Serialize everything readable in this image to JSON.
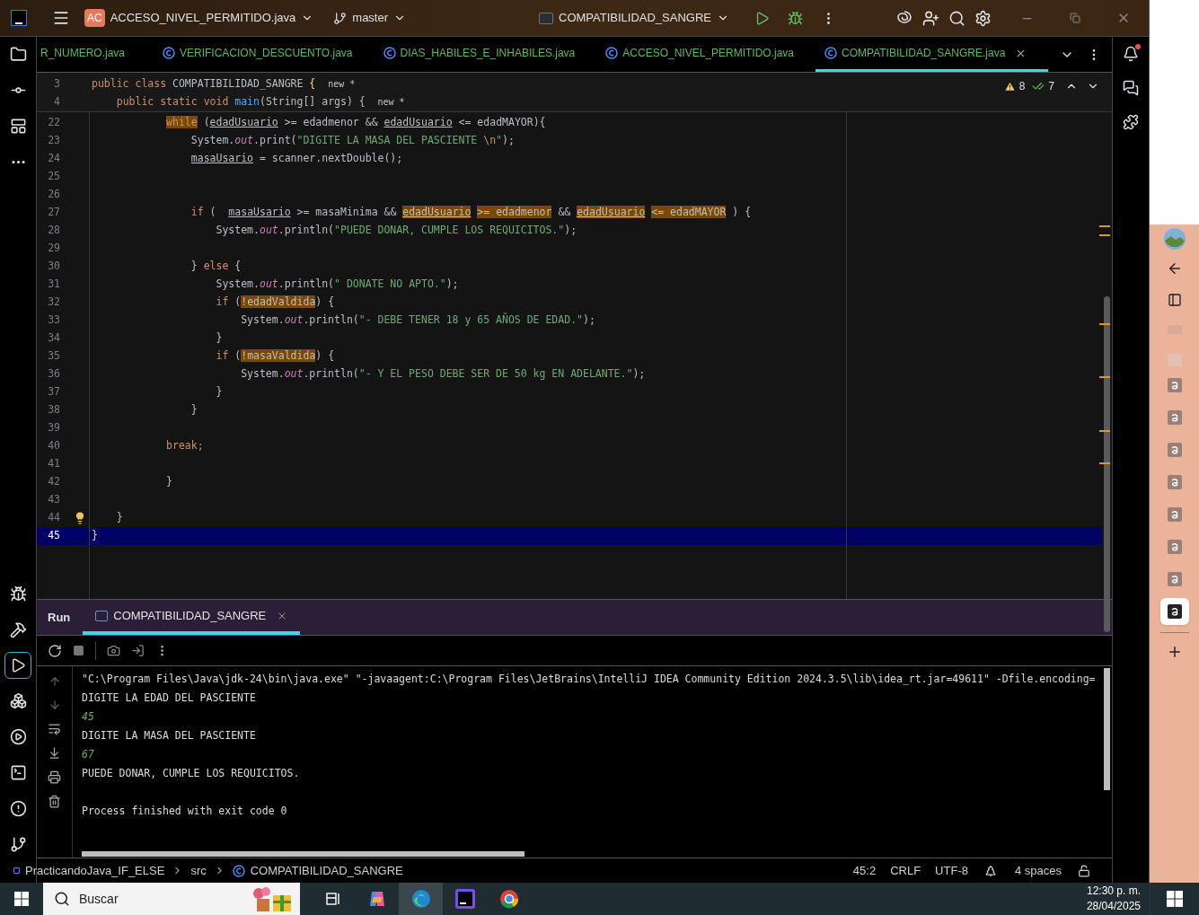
{
  "title_bar": {
    "project_badge": "AC",
    "project": "ACCESO_NIVEL_PERMITIDO.java",
    "branch": "master",
    "run_config": "COMPATIBILIDAD_SANGRE"
  },
  "tabs": [
    {
      "label": "R_NUMERO.java",
      "selected": false,
      "icon": false
    },
    {
      "label": "VERIFICACION_DESCUENTO.java",
      "selected": false,
      "icon": true
    },
    {
      "label": "DIAS_HABILES_E_INHABILES.java",
      "selected": false,
      "icon": true
    },
    {
      "label": "ACCESO_NIVEL_PERMITIDO.java",
      "selected": false,
      "icon": true
    },
    {
      "label": "COMPATIBILIDAD_SANGRE.java",
      "selected": true,
      "icon": true
    }
  ],
  "inspections": {
    "warnings": "8",
    "weak_warnings": "7"
  },
  "sticky_lines": [
    {
      "number": "3",
      "tokens": [
        {
          "kind": "kw",
          "text": "public class "
        },
        {
          "kind": "plain",
          "text": "COMPATIBILIDAD_SANGRE "
        },
        {
          "kind": "brace",
          "text": "{"
        },
        {
          "kind": "hint",
          "text": "  new *"
        }
      ]
    },
    {
      "number": "4",
      "tokens": [
        {
          "kind": "kw",
          "text": "    public static void "
        },
        {
          "kind": "fn",
          "text": "main"
        },
        {
          "kind": "plain",
          "text": "(String[] args) {"
        },
        {
          "kind": "hint",
          "text": "  new *"
        }
      ]
    }
  ],
  "code_lines": [
    {
      "number": "22",
      "current": false,
      "tokens": [
        {
          "kind": "hlkw",
          "text": "            while"
        },
        {
          "kind": "plain",
          "text": " ("
        },
        {
          "kind": "var",
          "text": "edadUsuario"
        },
        {
          "kind": "plain",
          "text": " >= edadmenor && "
        },
        {
          "kind": "var",
          "text": "edadUsuario"
        },
        {
          "kind": "plain",
          "text": " <= edadMAYOR){"
        }
      ]
    },
    {
      "number": "23",
      "current": false,
      "tokens": [
        {
          "kind": "plain",
          "text": "                System."
        },
        {
          "kind": "field",
          "text": "out"
        },
        {
          "kind": "plain",
          "text": ".print("
        },
        {
          "kind": "str",
          "text": "\"DIGITE LA MASA DEL PASCIENTE "
        },
        {
          "kind": "kw",
          "text": "\\n"
        },
        {
          "kind": "str",
          "text": "\""
        },
        {
          "kind": "plain",
          "text": ");"
        }
      ]
    },
    {
      "number": "24",
      "current": false,
      "tokens": [
        {
          "kind": "var",
          "text": "                masaUsario"
        },
        {
          "kind": "plain",
          "text": " = scanner.nextDouble();"
        }
      ]
    },
    {
      "number": "25",
      "current": false
    },
    {
      "number": "26",
      "current": false
    },
    {
      "number": "27",
      "current": false,
      "tokens": [
        {
          "kind": "kw",
          "text": "                if"
        },
        {
          "kind": "plain",
          "text": " (  "
        },
        {
          "kind": "var",
          "text": "masaUsario"
        },
        {
          "kind": "plain",
          "text": " >= masaMinima && "
        },
        {
          "kind": "hlvar",
          "text": "edadUsuario"
        },
        {
          "kind": "hl",
          "text": " >= edadmenor"
        },
        {
          "kind": "plain",
          "text": " && "
        },
        {
          "kind": "hlvar",
          "text": "edadUsuario"
        },
        {
          "kind": "hl",
          "text": " <= edadMAYOR"
        },
        {
          "kind": "plain",
          "text": " ) {"
        }
      ]
    },
    {
      "number": "28",
      "current": false,
      "tokens": [
        {
          "kind": "plain",
          "text": "                    System."
        },
        {
          "kind": "field",
          "text": "out"
        },
        {
          "kind": "plain",
          "text": ".println("
        },
        {
          "kind": "str",
          "text": "\"PUEDE DONAR, CUMPLE LOS REQUICITOS.\""
        },
        {
          "kind": "plain",
          "text": ");"
        }
      ]
    },
    {
      "number": "29",
      "current": false
    },
    {
      "number": "30",
      "current": false,
      "tokens": [
        {
          "kind": "plain",
          "text": "                } "
        },
        {
          "kind": "kw",
          "text": "else"
        },
        {
          "kind": "plain",
          "text": " {"
        }
      ]
    },
    {
      "number": "31",
      "current": false,
      "tokens": [
        {
          "kind": "plain",
          "text": "                    System."
        },
        {
          "kind": "field",
          "text": "out"
        },
        {
          "kind": "plain",
          "text": ".println("
        },
        {
          "kind": "str",
          "text": "\" DONATE NO APTO.\""
        },
        {
          "kind": "plain",
          "text": ");"
        }
      ]
    },
    {
      "number": "32",
      "current": false,
      "tokens": [
        {
          "kind": "kw",
          "text": "                    if"
        },
        {
          "kind": "plain",
          "text": " ("
        },
        {
          "kind": "hl",
          "text": "!edadValdida"
        },
        {
          "kind": "plain",
          "text": ") {"
        }
      ]
    },
    {
      "number": "33",
      "current": false,
      "tokens": [
        {
          "kind": "plain",
          "text": "                        System."
        },
        {
          "kind": "field",
          "text": "out"
        },
        {
          "kind": "plain",
          "text": ".println("
        },
        {
          "kind": "str",
          "text": "\"- DEBE TENER 18 y 65 AÑOS DE EDAD.\""
        },
        {
          "kind": "plain",
          "text": ");"
        }
      ]
    },
    {
      "number": "34",
      "current": false,
      "tokens": [
        {
          "kind": "plain",
          "text": "                    }"
        }
      ]
    },
    {
      "number": "35",
      "current": false,
      "tokens": [
        {
          "kind": "kw",
          "text": "                    if"
        },
        {
          "kind": "plain",
          "text": " ("
        },
        {
          "kind": "hl",
          "text": "!masaValdida"
        },
        {
          "kind": "plain",
          "text": ") {"
        }
      ]
    },
    {
      "number": "36",
      "current": false,
      "tokens": [
        {
          "kind": "plain",
          "text": "                        System."
        },
        {
          "kind": "field",
          "text": "out"
        },
        {
          "kind": "plain",
          "text": ".println("
        },
        {
          "kind": "str",
          "text": "\"- Y EL PESO DEBE SER DE 50 kg EN ADELANTE.\""
        },
        {
          "kind": "plain",
          "text": ");"
        }
      ]
    },
    {
      "number": "37",
      "current": false,
      "tokens": [
        {
          "kind": "plain",
          "text": "                    }"
        }
      ]
    },
    {
      "number": "38",
      "current": false,
      "tokens": [
        {
          "kind": "plain",
          "text": "                }"
        }
      ]
    },
    {
      "number": "39",
      "current": false
    },
    {
      "number": "40",
      "current": false,
      "tokens": [
        {
          "kind": "kw",
          "text": "            break;"
        }
      ]
    },
    {
      "number": "41",
      "current": false
    },
    {
      "number": "42",
      "current": false,
      "tokens": [
        {
          "kind": "plain",
          "text": "            }"
        }
      ]
    },
    {
      "number": "43",
      "current": false
    },
    {
      "number": "44",
      "current": false,
      "bulb": true,
      "tokens": [
        {
          "kind": "plain",
          "text": "    }"
        }
      ]
    },
    {
      "number": "45",
      "current": true,
      "tokens": [
        {
          "kind": "brace",
          "text": "}"
        }
      ]
    }
  ],
  "run_panel": {
    "title": "Run",
    "tabs": [
      {
        "label": "COMPATIBILIDAD_SANGRE",
        "selected": true
      }
    ],
    "console": [
      {
        "kind": "out",
        "text": "\"C:\\Program Files\\Java\\jdk-24\\bin\\java.exe\" \"-javaagent:C:\\Program Files\\JetBrains\\IntelliJ IDEA Community Edition 2024.3.5\\lib\\idea_rt.jar=49611\" -Dfile.encoding="
      },
      {
        "kind": "out",
        "text": "DIGITE LA EDAD DEL PASCIENTE"
      },
      {
        "kind": "input",
        "text": "45"
      },
      {
        "kind": "out",
        "text": "DIGITE LA MASA DEL PASCIENTE"
      },
      {
        "kind": "input",
        "text": "67"
      },
      {
        "kind": "out",
        "text": "PUEDE DONAR, CUMPLE LOS REQUICITOS."
      },
      {
        "kind": "blank"
      },
      {
        "kind": "out",
        "text": "Process finished with exit code 0"
      }
    ]
  },
  "status_bar": {
    "breadcrumbs": [
      "PracticandoJava_IF_ELSE",
      "src",
      "COMPATIBILIDAD_SANGRE"
    ],
    "position": "45:2",
    "line_ending": "CRLF",
    "encoding": "UTF-8",
    "indent": "4 spaces"
  },
  "taskbar": {
    "search_placeholder": "Buscar",
    "apps": [
      {
        "kind": "taskview",
        "selected": false
      },
      {
        "kind": "copilot",
        "selected": false
      },
      {
        "kind": "edge",
        "selected": true
      },
      {
        "kind": "intellij",
        "selected": false
      },
      {
        "kind": "chrome",
        "selected": false
      }
    ],
    "time": "12:30 p. m.",
    "date": "28/04/2025"
  },
  "browser_sidebar": {
    "tiles": [
      {
        "selected": false
      },
      {
        "selected": false
      },
      {
        "selected": false
      },
      {
        "selected": false
      },
      {
        "selected": false
      },
      {
        "selected": false
      },
      {
        "selected": false
      },
      {
        "selected": true
      }
    ]
  }
}
